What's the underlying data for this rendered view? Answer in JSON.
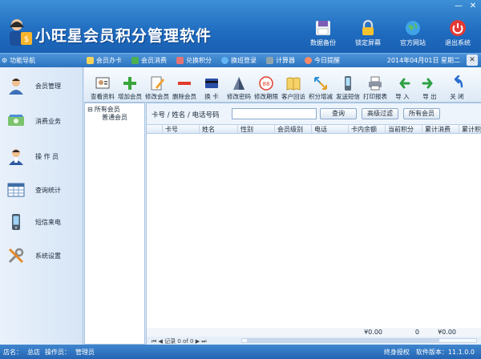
{
  "app": {
    "title": "小旺星会员积分管理软件"
  },
  "window_controls": {
    "minimize": "—",
    "close": "✕"
  },
  "sys_buttons": [
    {
      "label": "数据备份",
      "icon": "floppy-icon"
    },
    {
      "label": "锁定屏幕",
      "icon": "lock-icon"
    },
    {
      "label": "官方网站",
      "icon": "globe-icon"
    },
    {
      "label": "退出系统",
      "icon": "power-icon"
    }
  ],
  "navbar": {
    "title": "功能导航",
    "quick": [
      {
        "label": "会员办卡",
        "icon": "card-icon",
        "color": "#f5d35c"
      },
      {
        "label": "会员消费",
        "icon": "dollar-icon",
        "color": "#4caf50"
      },
      {
        "label": "兑换积分",
        "icon": "gift-icon",
        "color": "#e57373"
      },
      {
        "label": "换班登录",
        "icon": "refresh-icon",
        "color": "#64b5f6"
      },
      {
        "label": "计算器",
        "icon": "calculator-icon",
        "color": "#90a4ae"
      },
      {
        "label": "今日提醒",
        "icon": "alarm-icon",
        "color": "#ff8a65"
      }
    ],
    "date": "2014年04月01日  星期二",
    "close": "✕"
  },
  "sidebar": [
    {
      "label": "会员管理",
      "icon": "member-icon"
    },
    {
      "label": "消费业务",
      "icon": "cash-icon"
    },
    {
      "label": "操 作 员",
      "icon": "operator-icon"
    },
    {
      "label": "查询统计",
      "icon": "table-icon"
    },
    {
      "label": "短信来电",
      "icon": "phone-icon"
    },
    {
      "label": "系统设置",
      "icon": "tools-icon"
    }
  ],
  "toolbar": [
    {
      "label": "查看资料",
      "icon": "view-icon"
    },
    {
      "label": "增加会员",
      "icon": "plus-icon"
    },
    {
      "label": "修改会员",
      "icon": "edit-icon"
    },
    {
      "label": "删除会员",
      "icon": "minus-icon"
    },
    {
      "label": "换 卡",
      "icon": "swap-card-icon"
    },
    {
      "label": "修改密码",
      "icon": "key-icon"
    },
    {
      "label": "修改期限",
      "icon": "expiry-icon"
    },
    {
      "label": "客户回访",
      "icon": "book-icon"
    },
    {
      "label": "积分增减",
      "icon": "arrows-icon"
    },
    {
      "label": "发送短信",
      "icon": "sms-icon"
    },
    {
      "label": "打印报表",
      "icon": "print-icon"
    },
    {
      "label": "导 入",
      "icon": "import-icon"
    },
    {
      "label": "导 出",
      "icon": "export-icon"
    },
    {
      "label": "关 闭",
      "icon": "close-icon"
    }
  ],
  "tree": {
    "root": "所有会员",
    "child": "普通会员",
    "toggle": "⊟"
  },
  "search": {
    "label": "卡号 / 姓名 / 电话号码",
    "value": "",
    "query_button": "查询",
    "advanced_button": "高级过滤",
    "all_button": "所有会员"
  },
  "table": {
    "columns": [
      "",
      "卡号",
      "姓名",
      "性别",
      "会员级别",
      "电话",
      "卡内余额",
      "当前积分",
      "累计消费",
      "累计积分"
    ],
    "rows": [],
    "totals": [
      "",
      "",
      "",
      "",
      "",
      "",
      "¥0.00",
      "0",
      "¥0.00",
      ""
    ]
  },
  "pager": {
    "text": "⏮ ◀ 记录 0 of 0 ▶ ⏭"
  },
  "status": {
    "store_label": "店名：",
    "store": "总店",
    "operator_label": "操作员：",
    "operator": "管理员",
    "license": "终身授权",
    "version_label": "软件版本：",
    "version": "11.1.0.0"
  }
}
